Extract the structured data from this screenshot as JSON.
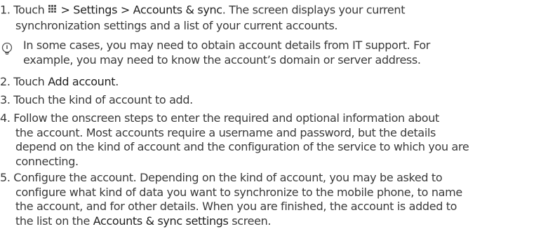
{
  "steps": {
    "s1": {
      "prefix": "1. Touch",
      "path": "> Settings > Accounts & sync",
      "rest_line1": ". The screen displays your current",
      "line2": "synchronization settings and a list of your current accounts."
    },
    "note": {
      "line1": "In some cases, you may need to obtain account details from IT support. For",
      "line2": "example, you may need to know the account’s domain or server address."
    },
    "s2": {
      "prefix": "2. Touch ",
      "bold": "Add account",
      "suffix": "."
    },
    "s3": {
      "text": "3. Touch the kind of account to add."
    },
    "s4": {
      "line1": "4. Follow the onscreen steps to enter the required and optional information about",
      "line2": "the account. Most accounts require a username and password, but the details",
      "line3": "depend on the kind of account and the configuration of the service to which you are",
      "line4": "connecting."
    },
    "s5": {
      "line1": "5. Configure the account. Depending on the kind of account, you may be asked to",
      "line2": "configure what kind of data you want to synchronize to the mobile phone, to name",
      "line3": "the account, and for other details. When you are finished, the account is added to",
      "line4_prefix": "the list on the ",
      "line4_bold": "Accounts & sync settings",
      "line4_suffix": " screen."
    }
  },
  "icons": {
    "menu": "menu-grid-icon",
    "note": "tip-lightbulb-icon"
  },
  "colors": {
    "text": "#3a3a3a",
    "bold_text": "#1f1f1f"
  }
}
